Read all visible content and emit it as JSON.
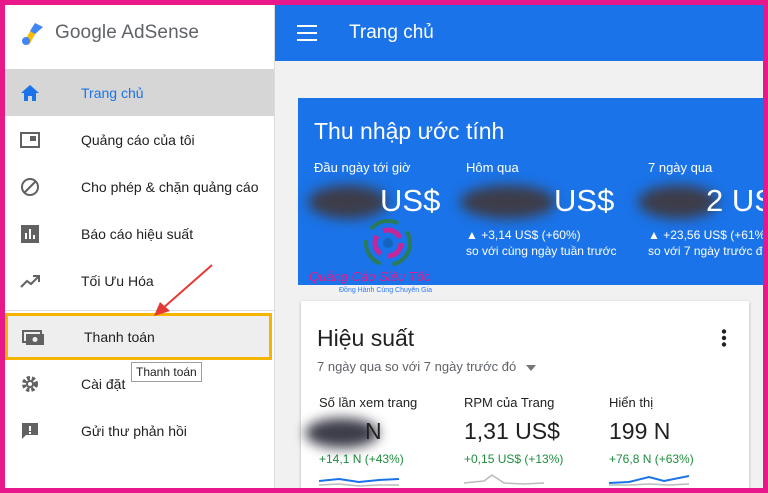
{
  "brand": {
    "name": "Google AdSense"
  },
  "header": {
    "title": "Trang chủ"
  },
  "sidebar": {
    "items": [
      {
        "label": "Trang chủ",
        "icon": "home-icon",
        "active": true
      },
      {
        "label": "Quảng cáo của tôi",
        "icon": "ad-units-icon"
      },
      {
        "label": "Cho phép & chặn quảng cáo",
        "icon": "block-icon"
      },
      {
        "label": "Báo cáo hiệu suất",
        "icon": "bar-chart-icon"
      },
      {
        "label": "Tối Ưu Hóa",
        "icon": "trending-icon"
      },
      {
        "label": "Thanh toán",
        "icon": "payments-icon",
        "highlighted": true
      },
      {
        "label": "Cài đặt",
        "icon": "settings-icon"
      },
      {
        "label": "Gửi thư phản hồi",
        "icon": "feedback-icon"
      }
    ],
    "tooltip": "Thanh toán"
  },
  "earnings": {
    "title": "Thu nhập ước tính",
    "cols": [
      {
        "label": "Đầu ngày tới giờ",
        "value": "US$",
        "change": ""
      },
      {
        "label": "Hôm qua",
        "value": "US$",
        "change": "▲ +3,14 US$ (+60%)",
        "note": "so với cùng ngày tuần trước"
      },
      {
        "label": "7 ngày qua",
        "value": "2 US",
        "change": "▲ +23,56 US$ (+61%",
        "note": "so với 7 ngày trước đ"
      }
    ]
  },
  "performance": {
    "title": "Hiệu suất",
    "range": "7 ngày qua so với 7 ngày trước đó",
    "cols": [
      {
        "label": "Số lần xem trang",
        "value": "N",
        "change": "+14,1 N (+43%)"
      },
      {
        "label": "RPM của Trang",
        "value": "1,31 US$",
        "change": "+0,15 US$ (+13%)"
      },
      {
        "label": "Hiển thị",
        "value": "199 N",
        "change": "+76,8 N (+63%)"
      }
    ]
  },
  "watermark": {
    "name": "Quảng Cáo Siêu Tốc",
    "tagline": "Đồng Hành Cùng Chuyên Gia"
  },
  "colors": {
    "accent": "#1a73e8",
    "highlight": "#f4b400",
    "border": "#e8188b",
    "positive": "#1e8e3e"
  }
}
